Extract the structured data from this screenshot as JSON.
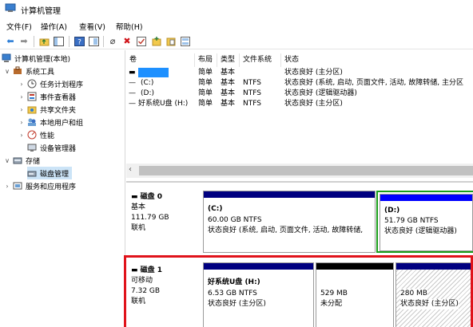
{
  "window": {
    "title": "计算机管理"
  },
  "menu": [
    "文件(F)",
    "操作(A)",
    "查看(V)",
    "帮助(H)"
  ],
  "toolbar": {
    "icons": [
      "back-icon",
      "forward-icon",
      "up-folder-icon",
      "console-tree-icon",
      "help-icon",
      "properties-icon",
      "connect-icon",
      "delete-icon",
      "check-icon",
      "new-icon",
      "open-icon",
      "view-icon"
    ]
  },
  "tree": {
    "root": "计算机管理(本地)",
    "system_tools": "系统工具",
    "task_scheduler": "任务计划程序",
    "event_viewer": "事件查看器",
    "shared_folders": "共享文件夹",
    "local_users": "本地用户和组",
    "performance": "性能",
    "device_manager": "设备管理器",
    "storage": "存储",
    "disk_mgmt": "磁盘管理",
    "services": "服务和应用程序"
  },
  "volume_table": {
    "headers": [
      "卷",
      "布局",
      "类型",
      "文件系统",
      "状态"
    ],
    "rows": [
      {
        "vol": "",
        "layout": "简单",
        "type": "基本",
        "fs": "",
        "status": "状态良好 (主分区)"
      },
      {
        "vol": "(C:)",
        "layout": "简单",
        "type": "基本",
        "fs": "NTFS",
        "status": "状态良好 (系统, 启动, 页面文件, 活动, 故障转储, 主分区"
      },
      {
        "vol": "(D:)",
        "layout": "简单",
        "type": "基本",
        "fs": "NTFS",
        "status": "状态良好 (逻辑驱动器)"
      },
      {
        "vol": "好系统U盘 (H:)",
        "layout": "简单",
        "type": "基本",
        "fs": "NTFS",
        "status": "状态良好 (主分区)"
      }
    ]
  },
  "disks": [
    {
      "name": "磁盘 0",
      "kind": "基本",
      "size": "111.79 GB",
      "state": "联机",
      "partitions": [
        {
          "label": "(C:)",
          "size": "60.00 GB NTFS",
          "status": "状态良好 (系统, 启动, 页面文件, 活动, 故障转储,"
        },
        {
          "label": "(D:)",
          "size": "51.79 GB NTFS",
          "status": "状态良好 (逻辑驱动器)"
        }
      ]
    },
    {
      "name": "磁盘 1",
      "kind": "可移动",
      "size": "7.32 GB",
      "state": "联机",
      "partitions": [
        {
          "label": "好系统U盘  (H:)",
          "size": "6.53 GB NTFS",
          "status": "状态良好 (主分区)"
        },
        {
          "label": "",
          "size": "529 MB",
          "status": "未分配"
        },
        {
          "label": "",
          "size": "280 MB",
          "status": "状态良好 (主分区)"
        }
      ]
    }
  ],
  "colors": {
    "primary_bar": "#000080",
    "logical_bar": "#0000ff",
    "unallocated_bar": "#000000",
    "extended_border": "#1a9e1a",
    "highlight": "#e0131b",
    "selected_volume": "#1e90ff"
  }
}
